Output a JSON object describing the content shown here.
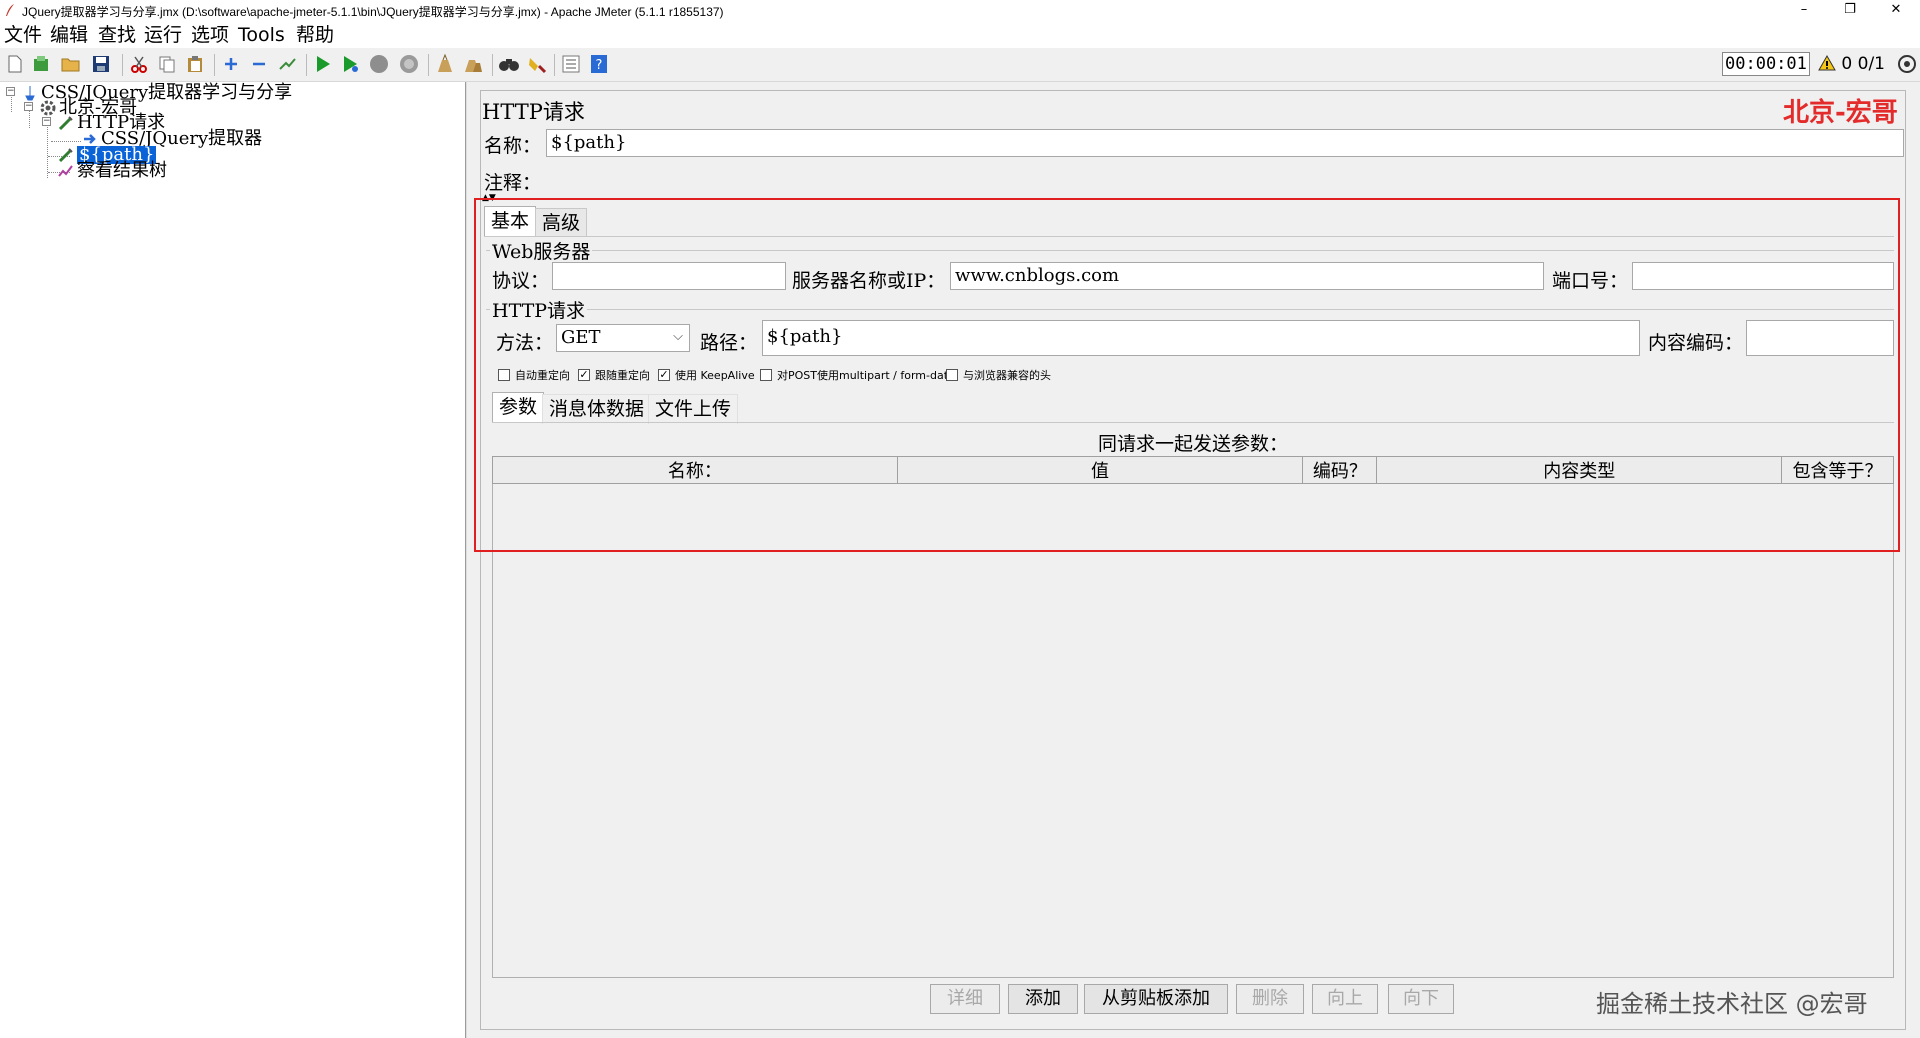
{
  "window": {
    "title": "JQuery提取器学习与分享.jmx (D:\\software\\apache-jmeter-5.1.1\\bin\\JQuery提取器学习与分享.jmx) - Apache JMeter (5.1.1 r1855137)",
    "minimize": "–",
    "restore": "❐",
    "close": "✕"
  },
  "menu": [
    "文件",
    "编辑",
    "查找",
    "运行",
    "选项",
    "Tools",
    "帮助"
  ],
  "toolbar": {
    "timer": "00:00:01",
    "warn_count": "0  0/1"
  },
  "tree": {
    "root": "CSS/JQuery提取器学习与分享",
    "thread_group": "北京-宏哥",
    "http_request": "HTTP请求",
    "extractor": "CSS/JQuery提取器",
    "selected_sampler": "${path}",
    "listener": "察看结果树"
  },
  "panel": {
    "heading": "HTTP请求",
    "watermark": "北京-宏哥",
    "name_label": "名称：",
    "name_value": "${path}",
    "comment_label": "注释：",
    "comment_value": "",
    "tabs": [
      "基本",
      "高级"
    ],
    "web_server": {
      "title": "Web服务器",
      "protocol_label": "协议：",
      "protocol_value": "",
      "server_label": "服务器名称或IP：",
      "server_value": "www.cnblogs.com",
      "port_label": "端口号：",
      "port_value": ""
    },
    "http_request": {
      "title": "HTTP请求",
      "method_label": "方法：",
      "method_value": "GET",
      "path_label": "路径：",
      "path_value": "${path}",
      "encoding_label": "内容编码：",
      "encoding_value": ""
    },
    "checkboxes": [
      {
        "label": "自动重定向",
        "checked": false
      },
      {
        "label": "跟随重定向",
        "checked": true
      },
      {
        "label": "使用 KeepAlive",
        "checked": true
      },
      {
        "label": "对POST使用multipart / form-data",
        "checked": false
      },
      {
        "label": "与浏览器兼容的头",
        "checked": false
      }
    ],
    "sub_tabs": [
      "参数",
      "消息体数据",
      "文件上传"
    ],
    "params_caption": "同请求一起发送参数：",
    "table_headers": [
      "名称：",
      "值",
      "编码？",
      "内容类型",
      "包含等于？"
    ],
    "buttons": [
      {
        "label": "详细",
        "enabled": false
      },
      {
        "label": "添加",
        "enabled": true
      },
      {
        "label": "从剪贴板添加",
        "enabled": true
      },
      {
        "label": "删除",
        "enabled": false
      },
      {
        "label": "向上",
        "enabled": false
      },
      {
        "label": "向下",
        "enabled": false
      }
    ],
    "bottom_watermark": "掘金稀土技术社区 @宏哥"
  }
}
